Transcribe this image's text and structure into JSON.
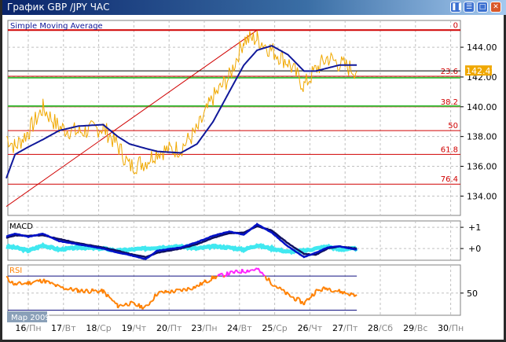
{
  "window": {
    "title": "График GBP /JPY  ЧАС",
    "buttons": [
      "pause",
      "minimize",
      "maximize",
      "close"
    ]
  },
  "colors": {
    "price": "#f0a800",
    "sma": "#10189a",
    "fib": "#d00000",
    "fib_green": "#40c040",
    "macd_main": "#0010c8",
    "macd_signal": "#101060",
    "macd_hist": "#40e8f0",
    "rsi": "#ff8000",
    "rsi_over": "#ff20ff",
    "rsi_under": "#30c030",
    "current_price_bg": "#f0a800",
    "grid": "#c0c0c0"
  },
  "chart_data": {
    "type": "line",
    "main": {
      "label": "Simple Moving Average",
      "ylim": [
        132.7,
        145.8
      ],
      "yticks": [
        "144.00",
        "142.00",
        "140.00",
        "138.00",
        "136.00",
        "134.00"
      ],
      "current_price": "142.41",
      "current_price_value": 142.41,
      "fib_levels": [
        {
          "label": "0",
          "value": 145.15
        },
        {
          "label": "23.6",
          "value": 142.05
        },
        {
          "label": "38.2",
          "value": 140.0
        },
        {
          "label": "50",
          "value": 138.4
        },
        {
          "label": "61.8",
          "value": 136.8
        },
        {
          "label": "76.4",
          "value": 134.8
        }
      ],
      "green_levels": [
        141.95,
        140.05
      ],
      "trendline": [
        {
          "t": "2009-03-15 09:00",
          "v": 133.3
        },
        {
          "t": "2009-03-24 12:00",
          "v": 145.15
        }
      ]
    },
    "macd": {
      "label": "MACD",
      "ylim": [
        -0.55,
        1.3
      ],
      "yticks": [
        {
          "label": "+1",
          "value": 1
        },
        {
          "label": "+0",
          "value": 0
        }
      ]
    },
    "rsi": {
      "label": "RSI",
      "ylim": [
        24,
        83
      ],
      "levels": [
        70,
        30
      ],
      "yticks": [
        {
          "label": "50",
          "value": 50
        }
      ]
    },
    "period_label": "Мар 2009",
    "x_labels": [
      {
        "d": "16",
        "w": "Пн"
      },
      {
        "d": "17",
        "w": "Вт"
      },
      {
        "d": "18",
        "w": "Ср"
      },
      {
        "d": "19",
        "w": "Чт"
      },
      {
        "d": "20",
        "w": "Пт"
      },
      {
        "d": "23",
        "w": "Пн"
      },
      {
        "d": "24",
        "w": "Вт"
      },
      {
        "d": "25",
        "w": "Ср"
      },
      {
        "d": "26",
        "w": "Чт"
      },
      {
        "d": "27",
        "w": "Пт"
      },
      {
        "d": "28",
        "w": "Сб"
      },
      {
        "d": "29",
        "w": "Вс"
      },
      {
        "d": "30",
        "w": "Пн"
      }
    ],
    "times": [
      "2009-03-15 09:00",
      "2009-03-15 15:00",
      "2009-03-16 00:00",
      "2009-03-16 10:00",
      "2009-03-16 21:00",
      "2009-03-17 10:00",
      "2009-03-18 03:00",
      "2009-03-18 13:00",
      "2009-03-18 21:00",
      "2009-03-19 08:00",
      "2009-03-19 16:00",
      "2009-03-20 08:00",
      "2009-03-20 19:00",
      "2009-03-23 06:00",
      "2009-03-23 17:00",
      "2009-03-24 03:00",
      "2009-03-24 12:00",
      "2009-03-24 22:00",
      "2009-03-25 09:00",
      "2009-03-25 20:00",
      "2009-03-26 04:00",
      "2009-03-26 12:00",
      "2009-03-26 20:00",
      "2009-03-27 08:00"
    ],
    "series": [
      {
        "key": "price",
        "values": [
          138.0,
          137.3,
          138.3,
          139.9,
          138.6,
          138.3,
          138.6,
          137.4,
          136.0,
          136.3,
          137.0,
          137.2,
          138.4,
          140.6,
          142.0,
          144.5,
          144.6,
          143.8,
          143.0,
          141.4,
          142.5,
          143.3,
          142.9,
          142.4
        ]
      },
      {
        "key": "sma",
        "name": "Simple Moving Average",
        "values": [
          135.2,
          136.8,
          137.3,
          137.8,
          138.4,
          138.7,
          138.8,
          138.0,
          137.5,
          137.2,
          137.0,
          136.9,
          137.5,
          139.0,
          141.0,
          142.8,
          143.8,
          144.1,
          143.5,
          142.4,
          142.4,
          142.6,
          142.8,
          142.8
        ]
      },
      {
        "key": "macd_main",
        "values": [
          0.57,
          0.7,
          0.55,
          0.7,
          0.35,
          0.2,
          0.0,
          -0.2,
          -0.3,
          -0.5,
          -0.1,
          0.05,
          0.3,
          0.6,
          0.8,
          0.65,
          1.15,
          0.75,
          0.1,
          -0.4,
          -0.2,
          0.05,
          0.1,
          -0.05
        ]
      },
      {
        "key": "macd_signal",
        "values": [
          0.5,
          0.62,
          0.6,
          0.62,
          0.45,
          0.25,
          0.05,
          -0.1,
          -0.25,
          -0.4,
          -0.2,
          0.0,
          0.2,
          0.5,
          0.72,
          0.75,
          1.05,
          0.85,
          0.25,
          -0.25,
          -0.3,
          0.0,
          0.1,
          0.0
        ]
      },
      {
        "key": "macd_hist",
        "values": [
          0.1,
          0.05,
          -0.1,
          0.15,
          -0.05,
          0.05,
          0.0,
          -0.1,
          -0.05,
          0.0,
          0.05,
          0.1,
          0.0,
          0.1,
          0.05,
          -0.05,
          0.15,
          0.0,
          -0.15,
          -0.1,
          0.0,
          0.1,
          -0.05,
          0.0
        ]
      },
      {
        "key": "rsi",
        "values": [
          68,
          60,
          62,
          65,
          57,
          53,
          52,
          35,
          38,
          33,
          50,
          53,
          58,
          68,
          73,
          76,
          78,
          62,
          48,
          38,
          52,
          56,
          52,
          47
        ]
      }
    ]
  }
}
